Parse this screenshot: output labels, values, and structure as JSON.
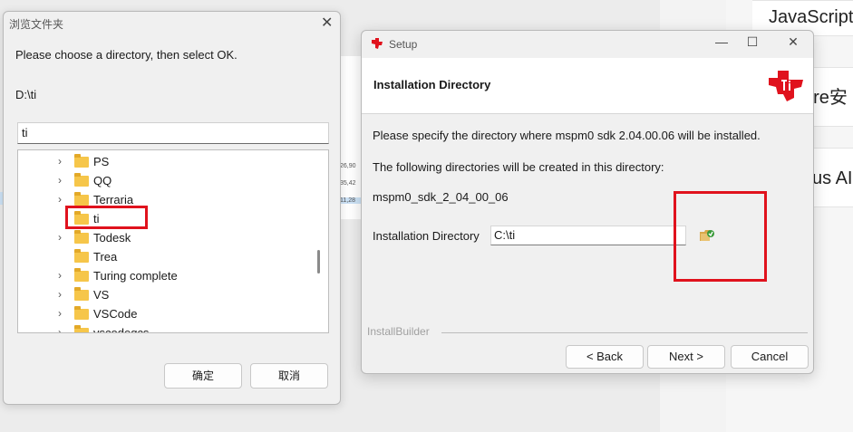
{
  "background": {
    "cards": [
      "JavaScript",
      "are安",
      "us AI"
    ],
    "numbers": [
      "26,90",
      "35,42",
      "11,28"
    ]
  },
  "browse_dialog": {
    "title": "浏览文件夹",
    "prompt": "Please choose a directory, then select OK.",
    "current_path": "D:\\ti",
    "folder_name": "ti",
    "tree": [
      {
        "label": "PS",
        "expandable": true
      },
      {
        "label": "QQ",
        "expandable": true
      },
      {
        "label": "Terraria",
        "expandable": true
      },
      {
        "label": "ti",
        "expandable": false,
        "selected": true
      },
      {
        "label": "Todesk",
        "expandable": true
      },
      {
        "label": "Trea",
        "expandable": false
      },
      {
        "label": "Turing complete",
        "expandable": true
      },
      {
        "label": "VS",
        "expandable": true
      },
      {
        "label": "VSCode",
        "expandable": true
      },
      {
        "label": "vscodeqcs",
        "expandable": true
      }
    ],
    "ok_label": "确定",
    "cancel_label": "取消"
  },
  "setup_dialog": {
    "title": "Setup",
    "header_title": "Installation Directory",
    "line1": "Please specify the directory where mspm0 sdk 2.04.00.06 will be installed.",
    "line2": "The following directories will be created in this directory:",
    "line3": "mspm0_sdk_2_04_00_06",
    "dir_label": "Installation Directory",
    "dir_value": "C:\\ti",
    "builder_label": "InstallBuilder",
    "back_label": "< Back",
    "next_label": "Next >",
    "cancel_label": "Cancel",
    "window_controls": [
      "—",
      "☐",
      "✕"
    ],
    "brand_color": "#e0121d"
  }
}
